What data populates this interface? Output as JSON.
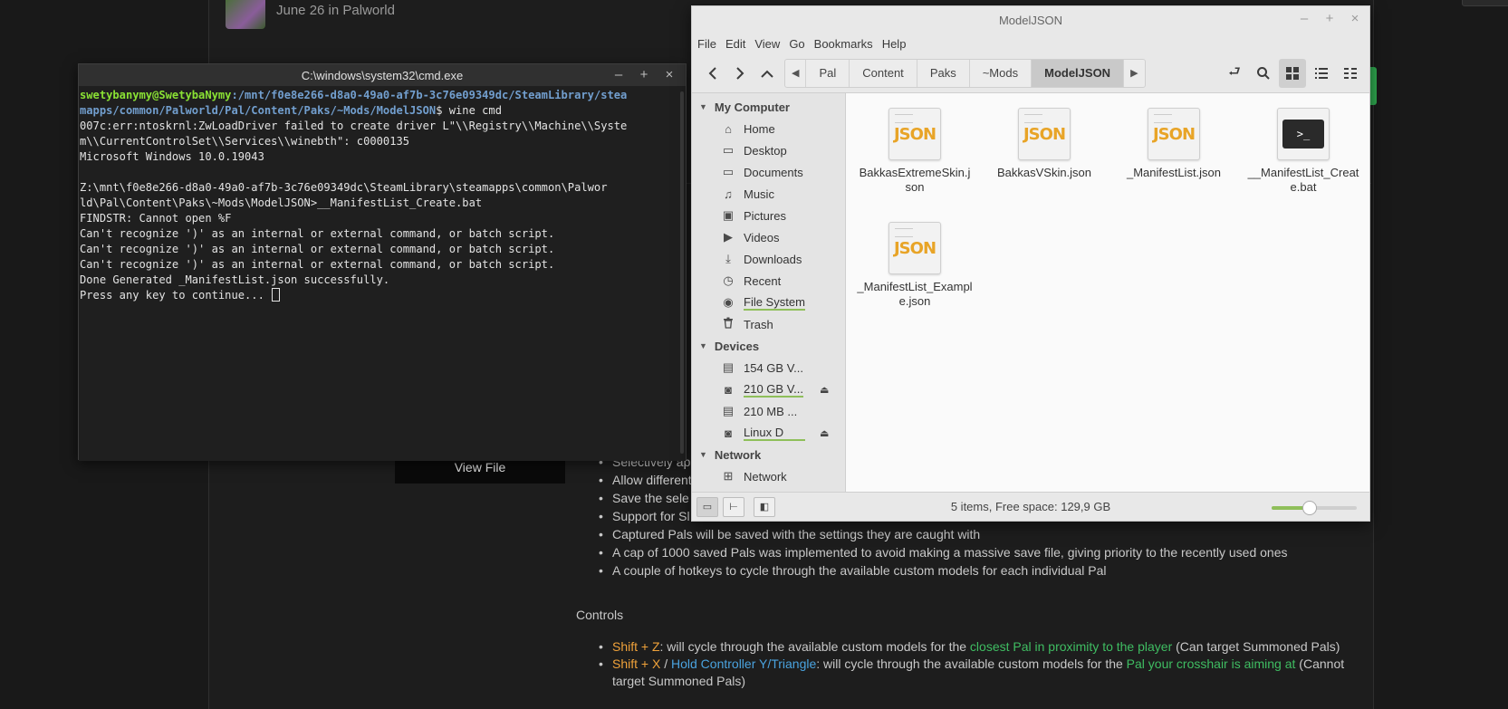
{
  "web": {
    "post_date": "June 26 in Palworld",
    "view_file": "View File",
    "features": [
      "Selectively ap",
      "Allow different",
      "Save the sele",
      "Support for Sl",
      "Captured Pals will be saved with the settings they are caught with",
      "A cap of 1000 saved Pals was implemented to avoid making a massive save file, giving priority to the recently used ones",
      "A couple of hotkeys to cycle through the available custom models for each individual Pal"
    ],
    "controls_title": "Controls",
    "control1": {
      "key": "Shift + Z",
      "text1": ": will cycle through the available custom models for the ",
      "target": "closest Pal in proximity to the player",
      "text2": " (Can target Summoned Pals)"
    },
    "control2": {
      "key": "Shift + X",
      "sep": " / ",
      "alt": "Hold Controller Y/Triangle",
      "text1": ": will cycle through the available custom models for the ",
      "target": "Pal your crosshair is aiming at",
      "text2": " (Cannot target Summoned Pals)"
    }
  },
  "terminal": {
    "title": "C:\\windows\\system32\\cmd.exe",
    "prompt_user": "swetybanymy@SwetybaNymy",
    "prompt_path_1": ":/mnt/f0e8e266-d8a0-49a0-af7b-3c76e09349dc/SteamLibrary/stea",
    "prompt_path_2": "mapps/common/Palworld/Pal/Content/Paks/~Mods/ModelJSON",
    "prompt_cmd": "$ wine cmd",
    "lines": [
      "007c:err:ntoskrnl:ZwLoadDriver failed to create driver L\"\\\\Registry\\\\Machine\\\\Syste",
      "m\\\\CurrentControlSet\\\\Services\\\\winebth\": c0000135",
      "Microsoft Windows 10.0.19043",
      "",
      "Z:\\mnt\\f0e8e266-d8a0-49a0-af7b-3c76e09349dc\\SteamLibrary\\steamapps\\common\\Palwor",
      "ld\\Pal\\Content\\Paks\\~Mods\\ModelJSON>__ManifestList_Create.bat",
      "FINDSTR: Cannot open %F",
      "Can't recognize ')' as an internal or external command, or batch script.",
      "Can't recognize ')' as an internal or external command, or batch script.",
      "Can't recognize ')' as an internal or external command, or batch script.",
      "Done Generated _ManifestList.json successfully."
    ],
    "last_line": "Press any key to continue... "
  },
  "file_manager": {
    "title": "ModelJSON",
    "menu": [
      "File",
      "Edit",
      "View",
      "Go",
      "Bookmarks",
      "Help"
    ],
    "breadcrumbs": [
      "Pal",
      "Content",
      "Paks",
      "~Mods",
      "ModelJSON"
    ],
    "active_crumb": "ModelJSON",
    "sidebar": {
      "my_computer": "My Computer",
      "places": [
        {
          "label": "Home",
          "icon": "home-icon",
          "glyph": "⌂"
        },
        {
          "label": "Desktop",
          "icon": "folder-icon",
          "glyph": "▭"
        },
        {
          "label": "Documents",
          "icon": "folder-icon",
          "glyph": "▭"
        },
        {
          "label": "Music",
          "icon": "music-icon",
          "glyph": "♫"
        },
        {
          "label": "Pictures",
          "icon": "pictures-icon",
          "glyph": "▣"
        },
        {
          "label": "Videos",
          "icon": "videos-icon",
          "glyph": "▶"
        },
        {
          "label": "Downloads",
          "icon": "download-icon",
          "glyph": "⤓"
        },
        {
          "label": "Recent",
          "icon": "clock-icon",
          "glyph": "◷"
        },
        {
          "label": "File System",
          "icon": "disk-icon",
          "glyph": "◉"
        },
        {
          "label": "Trash",
          "icon": "trash-icon",
          "glyph": "🗑"
        }
      ],
      "devices_title": "Devices",
      "devices": [
        {
          "label": "154 GB V...",
          "icon": "drive-icon"
        },
        {
          "label": "210 GB V...",
          "icon": "drive-icon"
        },
        {
          "label": "210 MB ...",
          "icon": "drive-icon"
        },
        {
          "label": "Linux D",
          "icon": "drive-icon"
        }
      ],
      "network_title": "Network",
      "network": [
        {
          "label": "Network",
          "icon": "network-icon"
        }
      ]
    },
    "files": [
      {
        "name": "BakkasExtremeSkin.json",
        "type": "json"
      },
      {
        "name": "BakkasVSkin.json",
        "type": "json"
      },
      {
        "name": "_ManifestList.json",
        "type": "json"
      },
      {
        "name": "__ManifestList_Create.bat",
        "type": "bat"
      },
      {
        "name": "_ManifestList_Example.json",
        "type": "json"
      }
    ],
    "json_badge": "JSON",
    "bat_badge": ">_",
    "status": "5 items, Free space: 129,9 GB",
    "zoom_level": 0.45
  }
}
